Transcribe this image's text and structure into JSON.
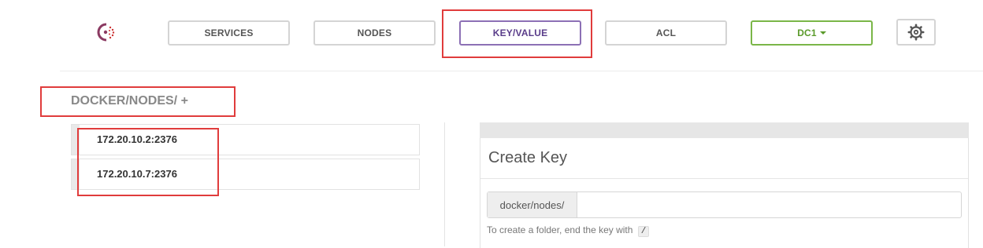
{
  "nav": {
    "services_label": "SERVICES",
    "nodes_label": "NODES",
    "keyvalue_label": "KEY/VALUE",
    "acl_label": "ACL",
    "datacenter_label": "DC1",
    "settings_icon": "gear-icon",
    "logo_icon": "consul-logo"
  },
  "breadcrumb": {
    "path": "DOCKER/NODES/",
    "add": "+"
  },
  "keys": [
    {
      "name": "172.20.10.2:2376"
    },
    {
      "name": "172.20.10.7:2376"
    }
  ],
  "create_key": {
    "title": "Create Key",
    "prefix": "docker/nodes/",
    "value": "",
    "placeholder": "",
    "help_text": "To create a folder, end the key with",
    "help_code": "/"
  },
  "colors": {
    "active_nav": "#8c70b5",
    "datacenter": "#7ab648",
    "annotation": "#e03c3c"
  }
}
